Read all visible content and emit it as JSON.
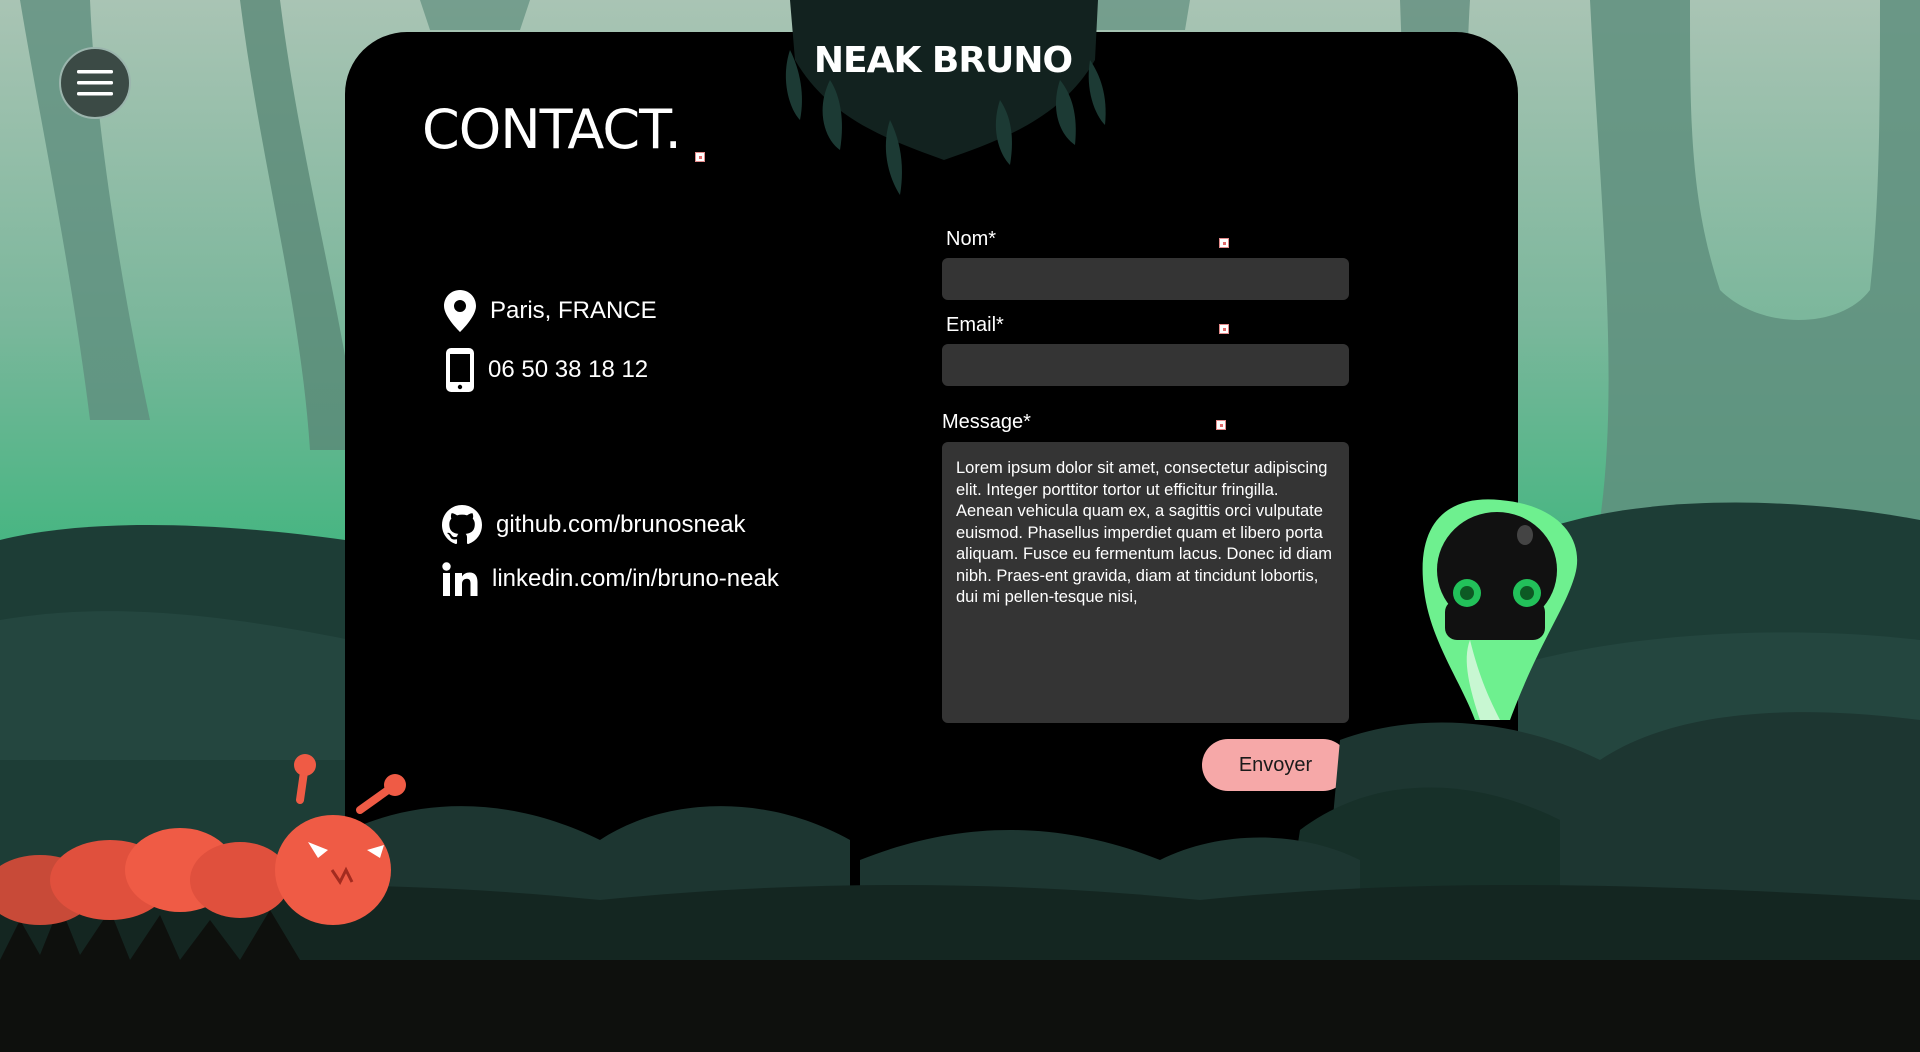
{
  "header": {
    "site_title": "NEAK BRUNO",
    "menu_icon": "hamburger-menu-icon"
  },
  "page": {
    "title": "CONTACT."
  },
  "contact_info": {
    "location": {
      "icon": "map-pin-icon",
      "text": "Paris, FRANCE"
    },
    "phone": {
      "icon": "smartphone-icon",
      "text": "06 50 38 18 12"
    }
  },
  "social": {
    "github": {
      "icon": "github-icon",
      "text": "github.com/brunosneak"
    },
    "linkedin": {
      "icon": "linkedin-icon",
      "text": "linkedin.com/in/bruno-neak"
    }
  },
  "form": {
    "name_label": "Nom*",
    "name_value": "",
    "email_label": "Email*",
    "email_value": "",
    "message_label": "Message*",
    "message_value": "Lorem ipsum dolor sit amet, consectetur adipiscing elit. Integer porttitor tortor ut efficitur fringilla. Aenean vehicula quam ex, a sagittis orci vulputate euismod. Phasellus imperdiet quam et libero porta aliquam. Fusce eu fermentum lacus. Donec id diam nibh. Praes-ent gravida, diam at tincidunt lobortis, dui mi pellen-tesque nisi,",
    "submit_label": "Envoyer"
  },
  "colors": {
    "sky_top": "#a9c4b4",
    "sky_bottom": "#3fb57e",
    "card": "#000000",
    "input_bg": "#343434",
    "button": "#f6a8a8",
    "caterpillar": "#ef5b45",
    "skull_glow": "#6ef08f"
  }
}
